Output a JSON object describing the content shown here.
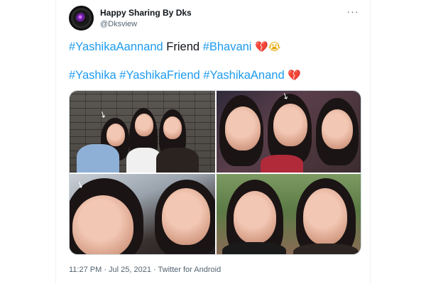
{
  "tweet": {
    "author": {
      "display_name": "Happy Sharing By Dks",
      "handle": "@Dksview"
    },
    "more_label": "···",
    "line1": {
      "tag1": "#YashikaAannand",
      "word": " Friend ",
      "tag2": "#Bhavani",
      "emoji1": "💔",
      "emoji2": "😭"
    },
    "line2": {
      "tag1": "#Yashika",
      "tag2": "#YashikaFriend",
      "tag3": "#YashikaAnand",
      "emoji1": "💔"
    },
    "media": {
      "arrow_glyph": "↘"
    },
    "timestamp": "11:27 PM · Jul 25, 2021 · Twitter for Android"
  },
  "colors": {
    "hashtag": "#1d9bf0",
    "text": "#0f1419",
    "muted": "#536471",
    "border": "#cfd9de"
  },
  "icons": {
    "avatar": "camera-lens-icon",
    "more": "more-options-icon",
    "arrow": "pointer-arrow-icon"
  }
}
